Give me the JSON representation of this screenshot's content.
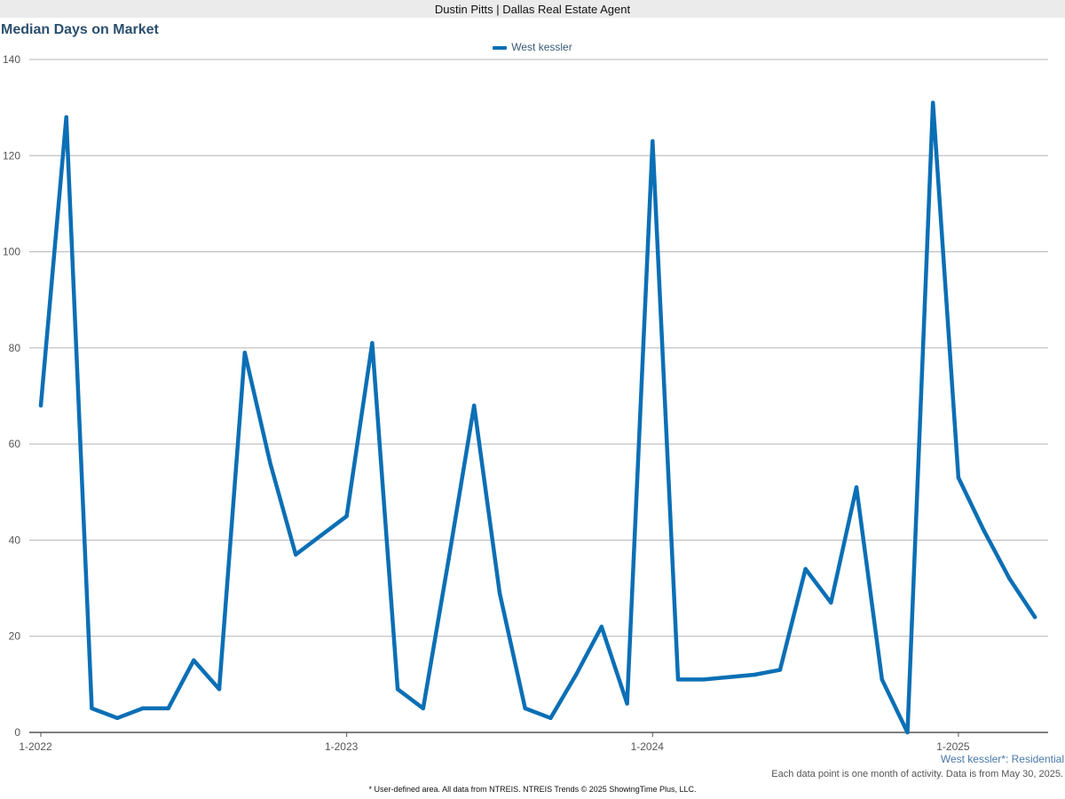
{
  "header": {
    "agent_label": "Dustin Pitts | Dallas Real Estate Agent"
  },
  "chart_data": {
    "type": "line",
    "title": "Median Days on Market",
    "xlabel": "",
    "ylabel": "",
    "ylim": [
      0,
      140
    ],
    "y_ticks": [
      0,
      20,
      40,
      60,
      80,
      100,
      120,
      140
    ],
    "x_tick_labels": [
      "1-2022",
      "1-2023",
      "1-2024",
      "1-2025"
    ],
    "grid": true,
    "legend_position": "top-center",
    "series": [
      {
        "name": "West kessler",
        "color": "#0b6fb5",
        "x": [
          "2022-01",
          "2022-02",
          "2022-03",
          "2022-04",
          "2022-05",
          "2022-06",
          "2022-07",
          "2022-08",
          "2022-09",
          "2022-10",
          "2022-11",
          "2022-12",
          "2023-01",
          "2023-02",
          "2023-03",
          "2023-04",
          "2023-05",
          "2023-06",
          "2023-07",
          "2023-08",
          "2023-09",
          "2023-10",
          "2023-11",
          "2023-12",
          "2024-01",
          "2024-02",
          "2024-03",
          "2024-04",
          "2024-05",
          "2024-06",
          "2024-07",
          "2024-08",
          "2024-09",
          "2024-10",
          "2024-11",
          "2024-12",
          "2025-01",
          "2025-02",
          "2025-03",
          "2025-04"
        ],
        "values": [
          68,
          128,
          5,
          3,
          5,
          5,
          15,
          9,
          79,
          56,
          37,
          41,
          45,
          81,
          9,
          5,
          36,
          68,
          29,
          5,
          3,
          12,
          22,
          6,
          123,
          11,
          11,
          null,
          12,
          13,
          34,
          27,
          51,
          11,
          0,
          131,
          53,
          42,
          32,
          24
        ]
      }
    ]
  },
  "notes": {
    "series_label": "West kessler*: Residential",
    "activity_note": "Each data point is one month of activity. Data is from May 30, 2025."
  },
  "footer": {
    "text": "* User-defined area. All data from NTREIS. NTREIS Trends © 2025 ShowingTime Plus, LLC."
  }
}
